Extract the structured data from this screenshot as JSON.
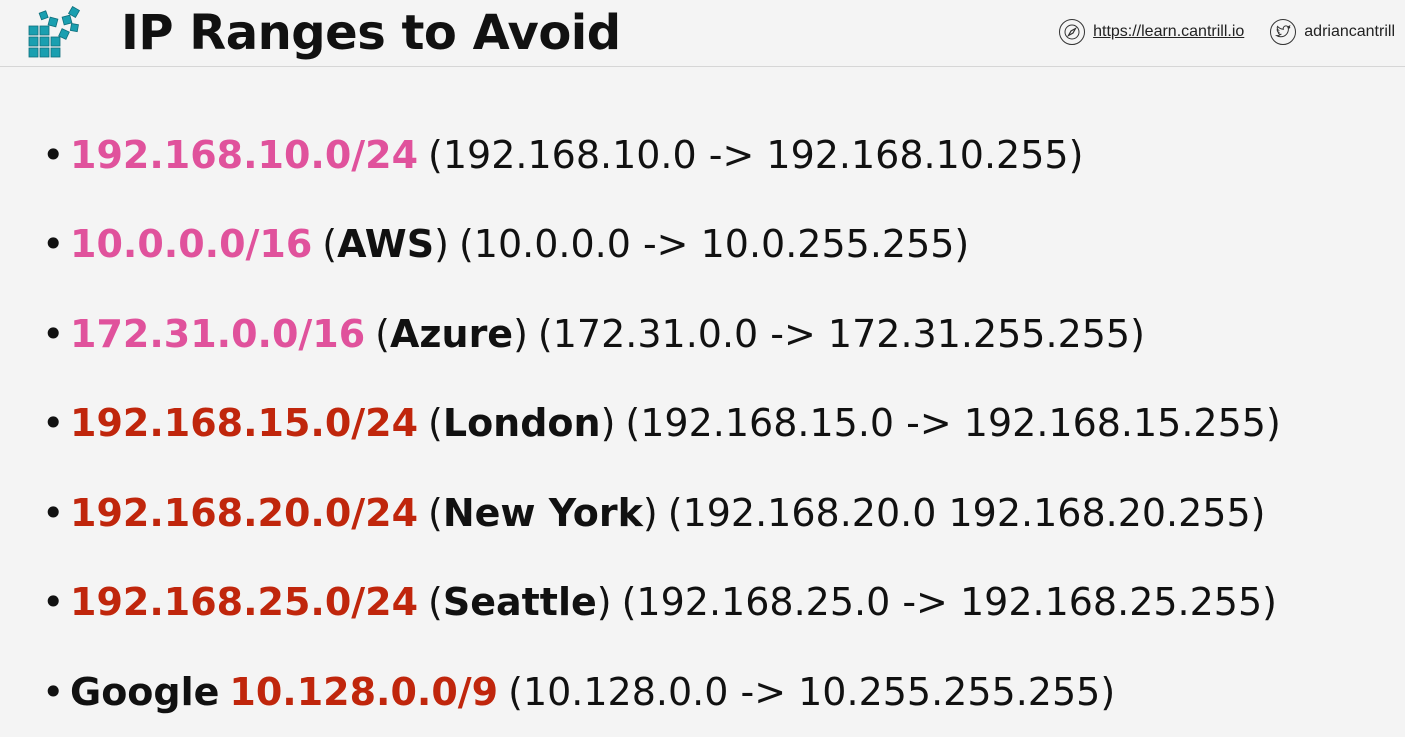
{
  "header": {
    "title": "IP Ranges to Avoid",
    "website": "https://learn.cantrill.io",
    "twitter": "adriancantrill",
    "icons": {
      "logo": "cantrill-logo-icon",
      "website": "compass-icon",
      "twitter": "twitter-bird-icon"
    }
  },
  "colors": {
    "pink": "#e0529c",
    "red": "#c0260c",
    "logo": "#1a9fb0"
  },
  "ranges": [
    {
      "cidr": "192.168.10.0/24",
      "cidr_color": "pink",
      "provider": "",
      "range": "(192.168.10.0 -> 192.168.10.255)"
    },
    {
      "cidr": "10.0.0.0/16",
      "cidr_color": "pink",
      "provider": "AWS",
      "range": "(10.0.0.0 -> 10.0.255.255)"
    },
    {
      "cidr": "172.31.0.0/16",
      "cidr_color": "pink",
      "provider": "Azure",
      "range": "(172.31.0.0 -> 172.31.255.255)"
    },
    {
      "cidr": "192.168.15.0/24",
      "cidr_color": "red",
      "provider": "London",
      "range": "(192.168.15.0 -> 192.168.15.255)"
    },
    {
      "cidr": "192.168.20.0/24",
      "cidr_color": "red",
      "provider": "New York",
      "range": "(192.168.20.0 192.168.20.255)"
    },
    {
      "cidr": "192.168.25.0/24",
      "cidr_color": "red",
      "provider": "Seattle",
      "range": "(192.168.25.0 -> 192.168.25.255)"
    },
    {
      "prefix": "Google",
      "cidr": "10.128.0.0/9",
      "cidr_color": "red",
      "range": "(10.128.0.0 -> 10.255.255.255)"
    }
  ]
}
